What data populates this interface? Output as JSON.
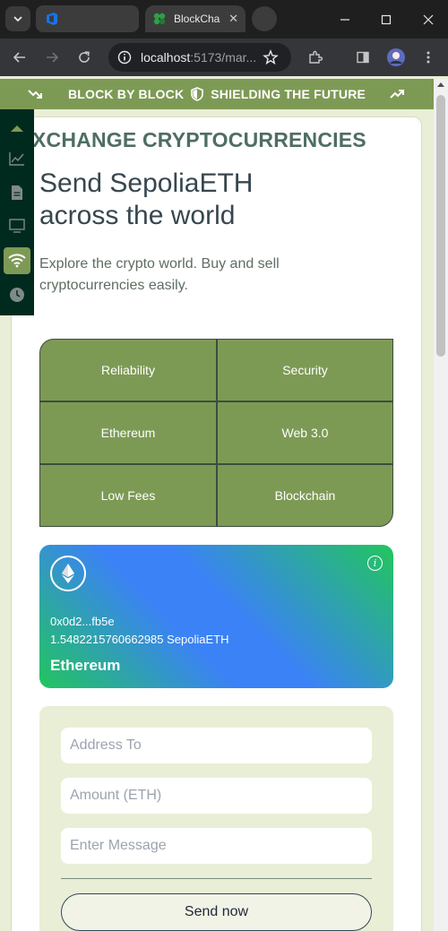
{
  "browser": {
    "tab_title": "BlockCha",
    "url_host": "localhost",
    "url_rest": ":5173/mar...",
    "window_controls": [
      "minimize",
      "maximize",
      "close"
    ]
  },
  "banner": {
    "left_text": "BLOCK BY BLOCK",
    "right_text": "SHIELDING THE FUTURE",
    "left_icon": "trend-down-icon",
    "center_icon": "shield-icon",
    "right_icon": "trend-up-icon",
    "color": "#7d9a55"
  },
  "sidebar": {
    "items": [
      {
        "icon": "chevron-up-icon"
      },
      {
        "icon": "chart-icon"
      },
      {
        "icon": "document-icon"
      },
      {
        "icon": "monitor-icon"
      },
      {
        "icon": "wifi-icon",
        "active": true
      },
      {
        "icon": "clock-icon"
      }
    ],
    "color": "#012a1e"
  },
  "hero": {
    "marquee": "XCHANGE CRYPTOCURRENCIES",
    "title_line1": "Send SepoliaETH",
    "title_line2": "across the world",
    "description": "Explore the crypto world. Buy and sell cryptocurrencies easily."
  },
  "features": [
    "Reliability",
    "Security",
    "Ethereum",
    "Web 3.0",
    "Low Fees",
    "Blockchain"
  ],
  "eth_card": {
    "address": "0x0d2...fb5e",
    "balance": "1.5482215760662985 SepoliaETH",
    "network": "Ethereum",
    "logo_icon": "ethereum-icon",
    "info_icon": "info-icon"
  },
  "form": {
    "address_placeholder": "Address To",
    "amount_placeholder": "Amount (ETH)",
    "message_placeholder": "Enter Message",
    "send_label": "Send now"
  }
}
